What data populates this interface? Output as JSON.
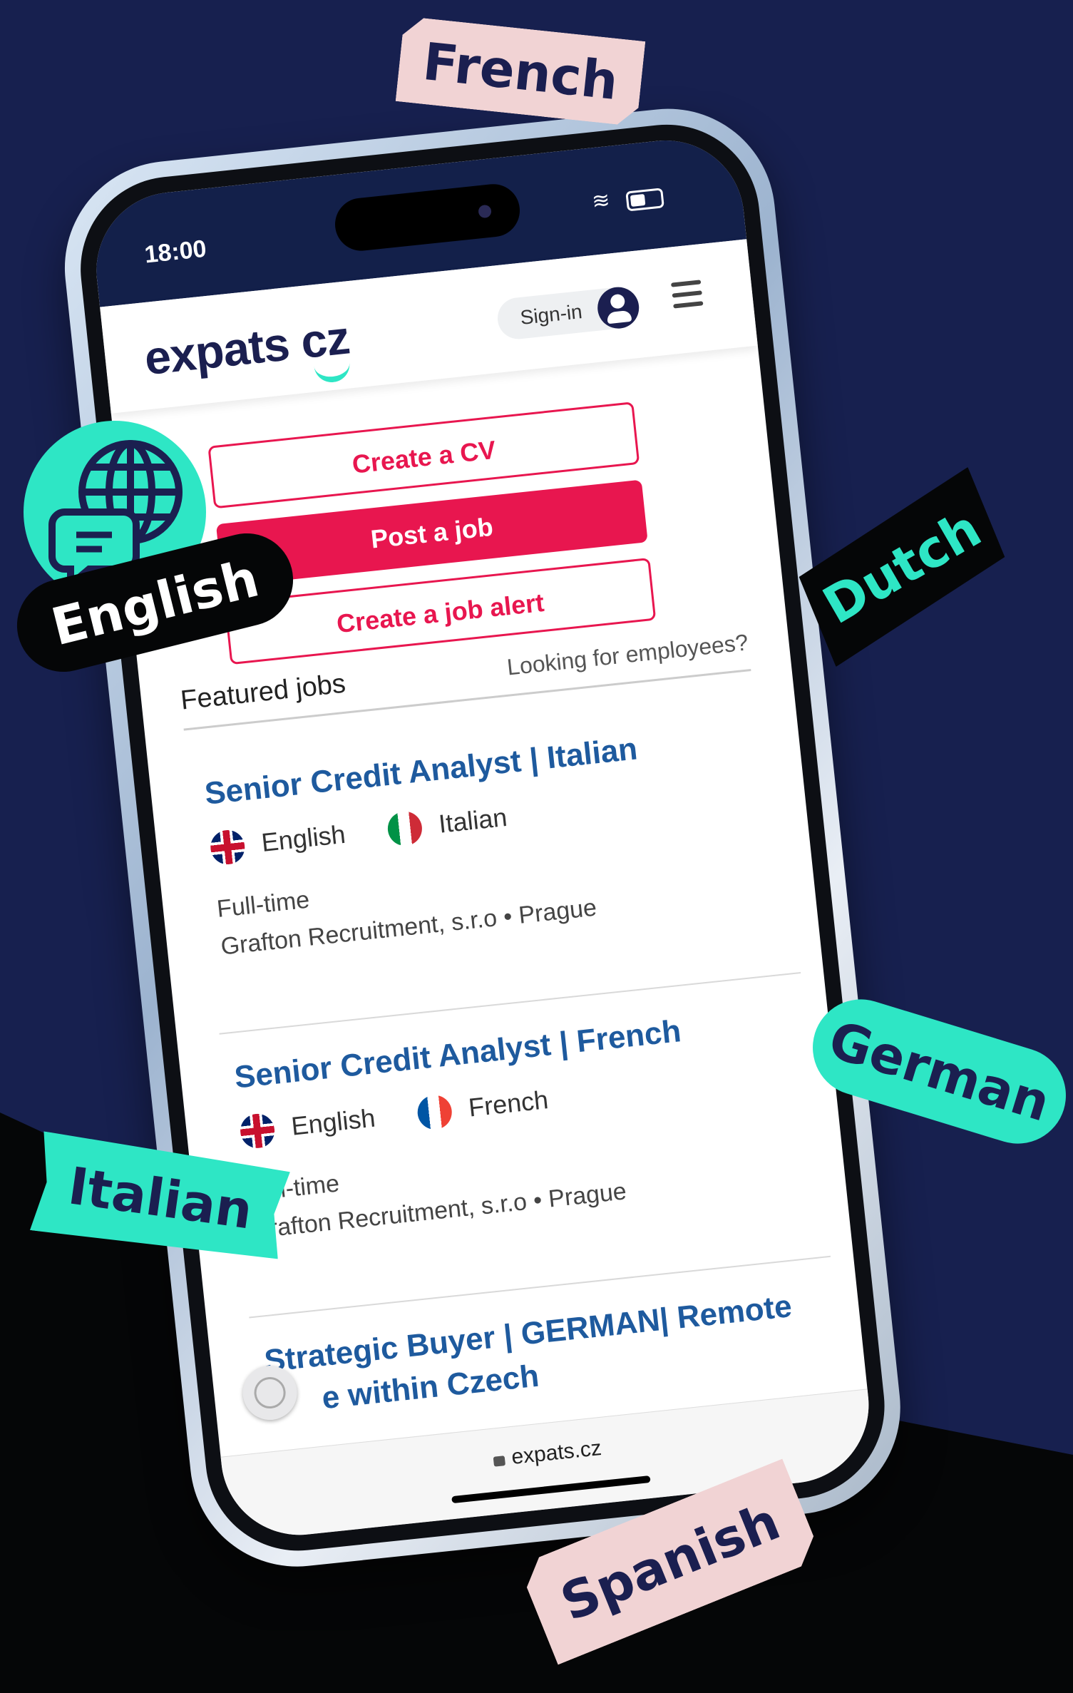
{
  "status_bar": {
    "time": "18:00"
  },
  "header": {
    "logo": "expats cz",
    "signin_label": "Sign-in"
  },
  "actions": {
    "create_cv": "Create a CV",
    "post_job": "Post a job",
    "create_alert": "Create a job alert"
  },
  "featured": {
    "title": "Featured jobs",
    "looking_link": "Looking for employees?"
  },
  "jobs": [
    {
      "title": "Senior Credit Analyst | Italian",
      "languages": [
        "English",
        "Italian"
      ],
      "type": "Full-time",
      "company_location": "Grafton Recruitment, s.r.o • Prague"
    },
    {
      "title": "Senior Credit Analyst | French",
      "languages": [
        "English",
        "French"
      ],
      "type": "Full-time",
      "company_location": "Grafton Recruitment, s.r.o • Prague"
    },
    {
      "title_line1": "Strategic Buyer | GERMAN| Remote",
      "title_line2": "e within Czech"
    }
  ],
  "browser": {
    "url": "expats.cz"
  },
  "stickers": {
    "french": "French",
    "english": "English",
    "dutch": "Dutch",
    "german": "German",
    "italian": "Italian",
    "spanish": "Spanish"
  },
  "colors": {
    "navy": "#17204f",
    "accent_red": "#e8164f",
    "teal": "#2ee6c5",
    "link_blue": "#1e5a9e"
  }
}
